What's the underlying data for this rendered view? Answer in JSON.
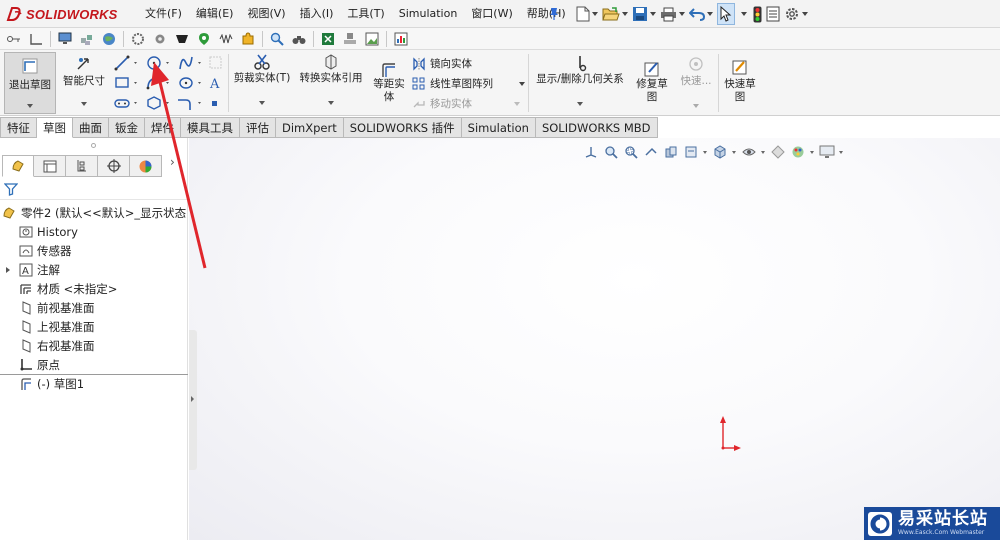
{
  "app": {
    "logo_text": "SOLIDWORKS"
  },
  "menu": [
    "文件(F)",
    "编辑(E)",
    "视图(V)",
    "插入(I)",
    "工具(T)",
    "Simulation",
    "窗口(W)",
    "帮助(H)"
  ],
  "ribbon": {
    "exit_sketch": "退出草图",
    "smart_dimension": "智能尺寸",
    "trim_entities": "剪裁实体(T)",
    "convert_entities": "转换实体引用",
    "offset_line1": "等距实",
    "offset_line2": "体",
    "mirror_entities": "镜向实体",
    "linear_pattern": "线性草图阵列",
    "move_entities": "移动实体",
    "display_relations": "显示/删除几何关系",
    "repair_line1": "修复草",
    "repair_line2": "图",
    "rapid_snaps": "快速...",
    "rapid_sketch_line1": "快速草",
    "rapid_sketch_line2": "图"
  },
  "tabs": [
    "特征",
    "草图",
    "曲面",
    "钣金",
    "焊件",
    "模具工具",
    "评估",
    "DimXpert",
    "SOLIDWORKS 插件",
    "Simulation",
    "SOLIDWORKS MBD"
  ],
  "active_tab": "草图",
  "tree": {
    "root": "零件2 (默认<<默认>_显示状态",
    "items": {
      "history": "History",
      "sensors": "传感器",
      "annotations": "注解",
      "material": "材质 <未指定>",
      "front_plane": "前视基准面",
      "top_plane": "上视基准面",
      "right_plane": "右视基准面",
      "origin": "原点",
      "sketch": "(-) 草图1"
    }
  },
  "watermark": {
    "title": "易采站长站",
    "subtitle": "Www.Easck.Com Webmaster"
  },
  "colors": {
    "brand_red": "#c4161c",
    "watermark_blue": "#1a4a9a",
    "arrow_red": "#e0262c"
  }
}
